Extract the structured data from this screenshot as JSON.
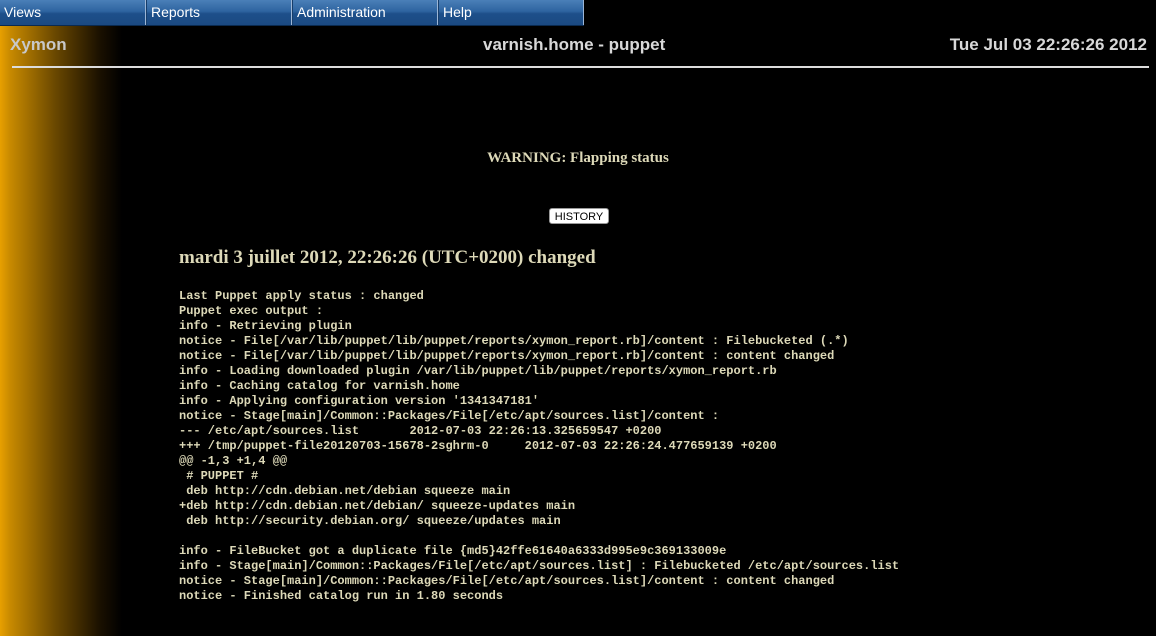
{
  "menu": {
    "items": [
      {
        "label": "Views"
      },
      {
        "label": "Reports"
      },
      {
        "label": "Administration"
      },
      {
        "label": "Help"
      }
    ]
  },
  "header": {
    "brand": "Xymon",
    "host": "varnish.home - puppet",
    "datetime": "Tue Jul 03 22:26:26 2012"
  },
  "warning": "WARNING: Flapping status",
  "history_button": "HISTORY",
  "status_title": "mardi 3 juillet 2012, 22:26:26 (UTC+0200) changed",
  "log_lines": [
    "Last Puppet apply status : changed",
    "Puppet exec output :",
    "info - Retrieving plugin",
    "notice - File[/var/lib/puppet/lib/puppet/reports/xymon_report.rb]/content : Filebucketed (.*)",
    "notice - File[/var/lib/puppet/lib/puppet/reports/xymon_report.rb]/content : content changed",
    "info - Loading downloaded plugin /var/lib/puppet/lib/puppet/reports/xymon_report.rb",
    "info - Caching catalog for varnish.home",
    "info - Applying configuration version '1341347181'",
    "notice - Stage[main]/Common::Packages/File[/etc/apt/sources.list]/content :",
    "--- /etc/apt/sources.list       2012-07-03 22:26:13.325659547 +0200",
    "+++ /tmp/puppet-file20120703-15678-2sghrm-0     2012-07-03 22:26:24.477659139 +0200",
    "@@ -1,3 +1,4 @@",
    " # PUPPET #",
    " deb http://cdn.debian.net/debian squeeze main",
    "+deb http://cdn.debian.net/debian/ squeeze-updates main",
    " deb http://security.debian.org/ squeeze/updates main",
    "",
    "info - FileBucket got a duplicate file {md5}42ffe61640a6333d995e9c369133009e",
    "info - Stage[main]/Common::Packages/File[/etc/apt/sources.list] : Filebucketed /etc/apt/sources.list",
    "notice - Stage[main]/Common::Packages/File[/etc/apt/sources.list]/content : content changed",
    "notice - Finished catalog run in 1.80 seconds"
  ]
}
